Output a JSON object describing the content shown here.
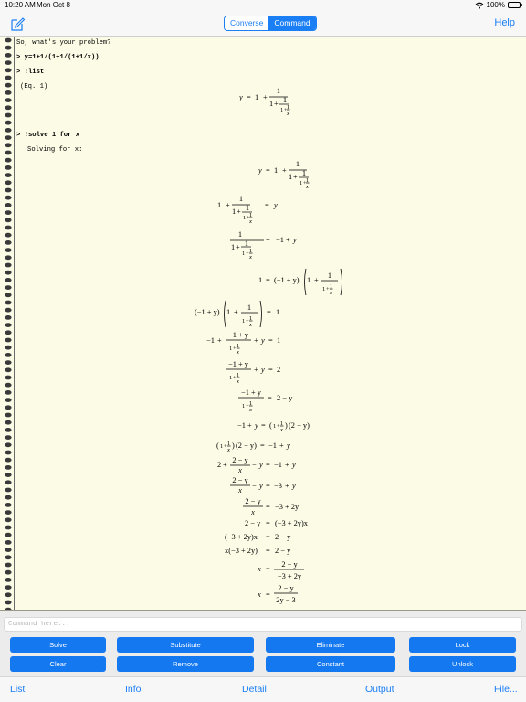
{
  "status_bar": {
    "time": "10:20 AM",
    "date": "Mon Oct 8",
    "battery": "100%",
    "icons": [
      "wifi-icon",
      "battery-icon"
    ]
  },
  "nav": {
    "compose_icon": "compose-icon",
    "segments": [
      {
        "label": "Converse",
        "selected": false
      },
      {
        "label": "Command",
        "selected": true
      }
    ],
    "help_label": "Help"
  },
  "transcript": {
    "line1": "So, what's your problem?",
    "cmd1": "> y=1+1/(1+1/(1+1/x))",
    "cmd2": "> !list",
    "eq_label": "(Eq. 1)",
    "cmd3": "> !solve 1 for x",
    "solving": "Solving for x:"
  },
  "math": {
    "one": "1",
    "y": "y",
    "x": "x",
    "plus": "+",
    "eq": "=",
    "minus": "−",
    "neg1": "−1",
    "two": "2",
    "three": "3",
    "neg3": "−3",
    "two_y": "2y",
    "m1py": "(−1 + y)",
    "m1py_top": "−1 + y",
    "two_my": "2 − y",
    "paren_2my": "(2 − y)",
    "two_y_m3": "2y − 3",
    "m3p2y": "(−3 + 2y)",
    "m3p2y_x": "(−3 + 2y)x",
    "x_m3p2y": "x(−3 + 2y)",
    "m3p2y_plain": "−3 + 2y",
    "lp": "(",
    "rp": ")"
  },
  "command_input": {
    "placeholder": "Command here...",
    "value": ""
  },
  "buttons": {
    "row1": [
      "Solve",
      "Substitute",
      "Eliminate",
      "Lock"
    ],
    "row2": [
      "Clear",
      "Remove",
      "Constant",
      "Unlock"
    ]
  },
  "colors": {
    "accent": "#1a7ef5",
    "button": "#1478f0",
    "paper": "#fbfbe6"
  },
  "tabs": [
    "List",
    "Info",
    "Detail",
    "Output",
    "File..."
  ]
}
